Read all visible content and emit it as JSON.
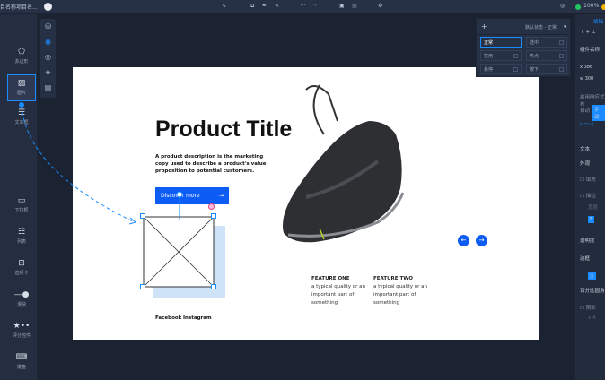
{
  "topbar": {
    "project_name": "目名称项目名...",
    "zoom": "100%"
  },
  "left_widgets": [
    {
      "label": "多边形",
      "icon": "pentagon-icon"
    },
    {
      "label": "图片",
      "icon": "image-icon"
    },
    {
      "label": "文本框",
      "icon": "textbox-icon"
    },
    {
      "label": "下拉框",
      "icon": "dropdown-icon"
    },
    {
      "label": "列表",
      "icon": "list-icon"
    },
    {
      "label": "选项卡",
      "icon": "tabs-icon"
    },
    {
      "label": "滑块",
      "icon": "slider-icon"
    },
    {
      "label": "评分控件",
      "icon": "rating-icon"
    },
    {
      "label": "键盘",
      "icon": "keyboard-icon"
    }
  ],
  "state_popup": {
    "title": "默认状态 - 正常",
    "states": [
      "正常",
      "选中",
      "禁用",
      "焦点",
      "悬停",
      "按下"
    ]
  },
  "artboard": {
    "title": "Product Title",
    "description": "A product description is the marketing copy used to describe a product's value proposition to potential customers.",
    "button": "Discover more",
    "features": [
      {
        "title": "FEATURE ONE",
        "text": "a typical quality or an important part of something"
      },
      {
        "title": "FEATURE TWO",
        "text": "a typical quality or an important part of something"
      }
    ],
    "links": [
      "Facebook",
      "Instagram"
    ]
  },
  "right_panel": {
    "tab": "编辑",
    "component_name": "组件名称",
    "x_label": "x",
    "x": "386",
    "w_label": "w",
    "w": "300",
    "responsive": "启用响应式布",
    "auto": "自动",
    "manual": "手动",
    "text": "文本",
    "appearance": "外观",
    "fill": "填充",
    "stroke": "描边",
    "width": "宽度",
    "opacity": "透明度",
    "border": "边框",
    "radius": "百分比圆角",
    "shadow": "阴影",
    "shadow_x": "x  4"
  },
  "colors": {
    "accent": "#1a8cff",
    "button": "#0d5cf5",
    "canvas": "#1b2232",
    "panel": "#252e40"
  }
}
